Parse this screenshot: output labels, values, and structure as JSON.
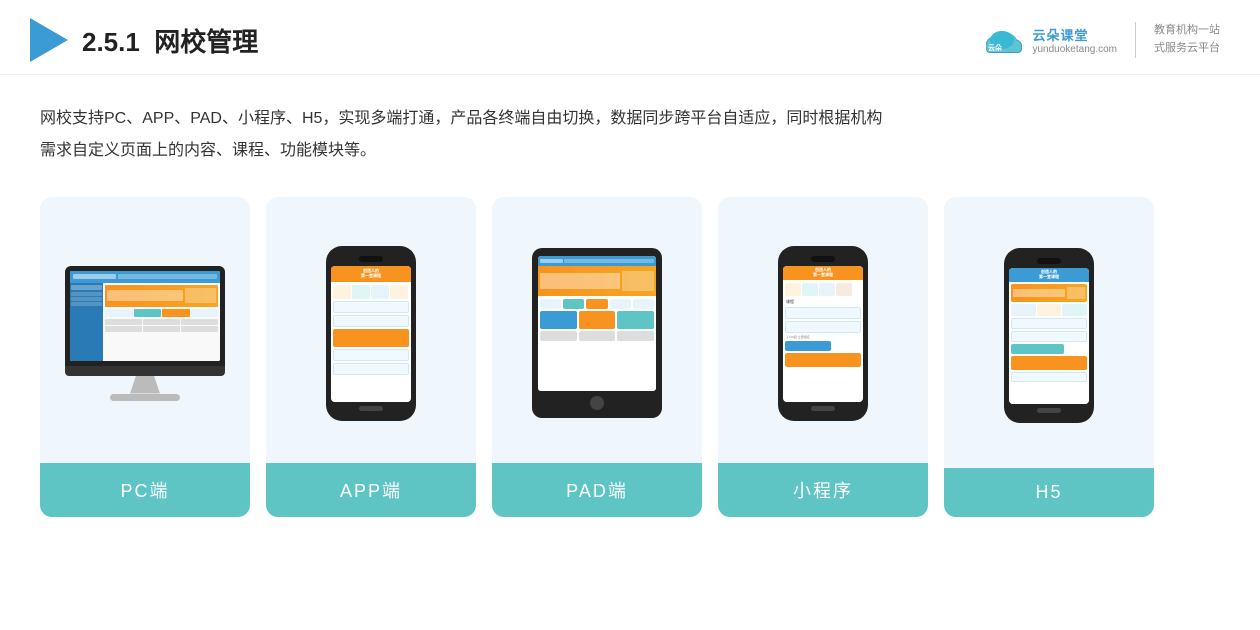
{
  "header": {
    "section_number": "2.5.1",
    "title_plain": "网校管理",
    "brand_name": "云朵课堂",
    "brand_url": "yunduoketang.com",
    "brand_slogan_line1": "教育机构一站",
    "brand_slogan_line2": "式服务云平台"
  },
  "content": {
    "description_line1": "网校支持PC、APP、PAD、小程序、H5，实现多端打通，产品各终端自由切换，数据同步跨平台自适应，同时根据机构",
    "description_line2": "需求自定义页面上的内容、课程、功能模块等。"
  },
  "cards": [
    {
      "id": "pc",
      "label": "PC端"
    },
    {
      "id": "app",
      "label": "APP端"
    },
    {
      "id": "pad",
      "label": "PAD端"
    },
    {
      "id": "miniapp",
      "label": "小程序"
    },
    {
      "id": "h5",
      "label": "H5"
    }
  ]
}
